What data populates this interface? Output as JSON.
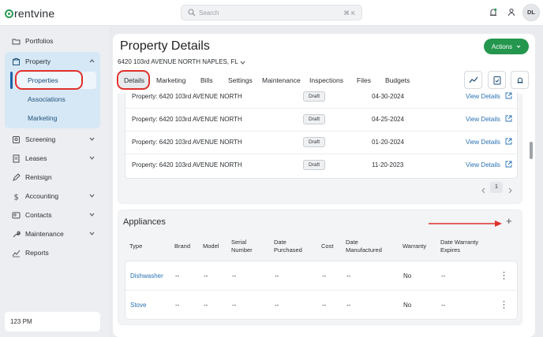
{
  "header": {
    "logo_text": "rentvine",
    "search_placeholder": "Search",
    "search_shortcut": "⌘ K",
    "avatar_initials": "DL",
    "icons": [
      "bell-icon",
      "person-icon"
    ]
  },
  "sidebar": {
    "items": [
      {
        "label": "Portfolios",
        "icon": "folder-icon"
      },
      {
        "label": "Property",
        "icon": "building-icon"
      },
      {
        "label": "Screening",
        "icon": "screening-icon"
      },
      {
        "label": "Leases",
        "icon": "document-icon"
      },
      {
        "label": "Rentsign",
        "icon": "pen-icon"
      },
      {
        "label": "Accounting",
        "icon": "dollar-icon"
      },
      {
        "label": "Contacts",
        "icon": "contacts-icon"
      },
      {
        "label": "Maintenance",
        "icon": "wrench-icon"
      },
      {
        "label": "Reports",
        "icon": "chart-icon"
      }
    ],
    "property_sub": [
      "Properties",
      "Associations",
      "Marketing"
    ],
    "footer_text": "123 PM"
  },
  "main": {
    "title": "Property Details",
    "address": "6420 103rd AVENUE NORTH NAPLES, FL",
    "actions_label": "Actions",
    "tabs": [
      "Details",
      "Marketing",
      "Bills",
      "Settings",
      "Maintenance",
      "Inspections",
      "Files",
      "Budgets"
    ],
    "documents": [
      {
        "name": "Property: 6420 103rd AVENUE NORTH",
        "status": "Draft",
        "date": "04-30-2024",
        "link": "View Details"
      },
      {
        "name": "Property: 6420 103rd AVENUE NORTH",
        "status": "Draft",
        "date": "04-25-2024",
        "link": "View Details"
      },
      {
        "name": "Property: 6420 103rd AVENUE NORTH",
        "status": "Draft",
        "date": "01-20-2024",
        "link": "View Details"
      },
      {
        "name": "Property: 6420 103rd AVENUE NORTH",
        "status": "Draft",
        "date": "11-20-2023",
        "link": "View Details"
      }
    ],
    "pager": {
      "current_page": "1"
    },
    "appliances": {
      "title": "Appliances",
      "add_label": "+",
      "columns": [
        {
          "line1": "Type",
          "line2": ""
        },
        {
          "line1": "Brand",
          "line2": ""
        },
        {
          "line1": "Model",
          "line2": ""
        },
        {
          "line1": "Serial",
          "line2": "Number"
        },
        {
          "line1": "Date",
          "line2": "Purchased"
        },
        {
          "line1": "Cost",
          "line2": ""
        },
        {
          "line1": "Date",
          "line2": "Manufactured"
        },
        {
          "line1": "Warranty",
          "line2": ""
        },
        {
          "line1": "Date Warranty",
          "line2": "Expires"
        }
      ],
      "rows": [
        {
          "type": "Dishwasher",
          "brand": "--",
          "model": "--",
          "serial": "--",
          "purchased": "--",
          "cost": "--",
          "manufactured": "--",
          "warranty": "No",
          "expires": "--"
        },
        {
          "type": "Stove",
          "brand": "--",
          "model": "--",
          "serial": "--",
          "purchased": "--",
          "cost": "--",
          "manufactured": "--",
          "warranty": "No",
          "expires": "--"
        }
      ]
    }
  },
  "colors": {
    "accent_green": "#24964e",
    "link_blue": "#2a72b5",
    "annotation_red": "#e0312b"
  }
}
